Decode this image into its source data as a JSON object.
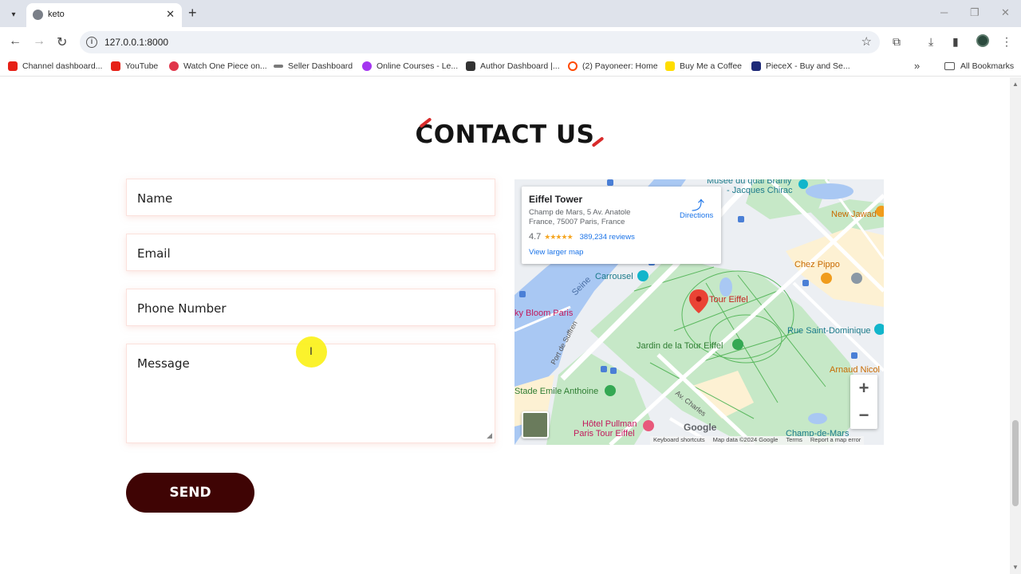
{
  "browser": {
    "tab_title": "keto",
    "url": "127.0.0.1:8000",
    "new_tab_symbol": "+",
    "tab_close_symbol": "✕",
    "bookmarks": [
      {
        "label": "Channel dashboard...",
        "color": "#e62117"
      },
      {
        "label": "YouTube",
        "color": "#e62117"
      },
      {
        "label": "Watch One Piece on...",
        "color": "#e0354a"
      },
      {
        "label": "Seller Dashboard",
        "color": "#7a7a7a"
      },
      {
        "label": "Online Courses - Le...",
        "color": "#a435f0"
      },
      {
        "label": "Author Dashboard |...",
        "color": "#333333"
      },
      {
        "label": "(2) Payoneer: Home",
        "color": "#ff4800"
      },
      {
        "label": "Buy Me a Coffee",
        "color": "#ffdd00"
      },
      {
        "label": "PieceX - Buy and Se...",
        "color": "#1e2a78"
      }
    ],
    "all_bookmarks": "All Bookmarks",
    "more_symbol": "»"
  },
  "contact": {
    "heading": "CONTACT US",
    "fields": {
      "name": "Name",
      "email": "Email",
      "phone": "Phone Number",
      "message": "Message"
    },
    "send_label": "SEND"
  },
  "map": {
    "card": {
      "title": "Eiffel Tower",
      "address": "Champ de Mars, 5 Av. Anatole France, 75007 Paris, France",
      "rating": "4.7",
      "stars": "★★★★★",
      "reviews": "389,234 reviews",
      "view_larger": "View larger map",
      "directions": "Directions"
    },
    "labels": {
      "musee": "Musée du quai Branly",
      "chirac": "- Jacques Chirac",
      "new_jawad": "New Jawad",
      "carrousel": "Carrousel",
      "chez_pippo": "Chez Pippo",
      "seine": "Seine",
      "sky_bloom": "ky Bloom Paris",
      "tour_eiffel": "Tour Eiffel",
      "rue_st_dominique": "Rue Saint-Dominique",
      "port_de_suffren": "Port de Suffren",
      "jardin": "Jardin de la Tour Eiffel",
      "arnaud_nicol": "Arnaud Nicol",
      "stade": "Stade Emile Anthoine",
      "av_charles": "Av. Charles",
      "hotel_pullman": "Hôtel Pullman",
      "hotel_pullman2": "Paris Tour Eiffel",
      "champ_de_mars": "Champ-de-Mars",
      "google": "Google"
    },
    "attribution": {
      "shortcuts": "Keyboard shortcuts",
      "data": "Map data ©2024 Google",
      "terms": "Terms",
      "report": "Report a map error"
    },
    "zoom_in": "+",
    "zoom_out": "−"
  },
  "colors": {
    "accent_slash": "#d92b2b",
    "send_button": "#3f0404",
    "map_water": "#a9c8f3",
    "map_park": "#c8e6c9",
    "map_pin": "#ea4335"
  }
}
